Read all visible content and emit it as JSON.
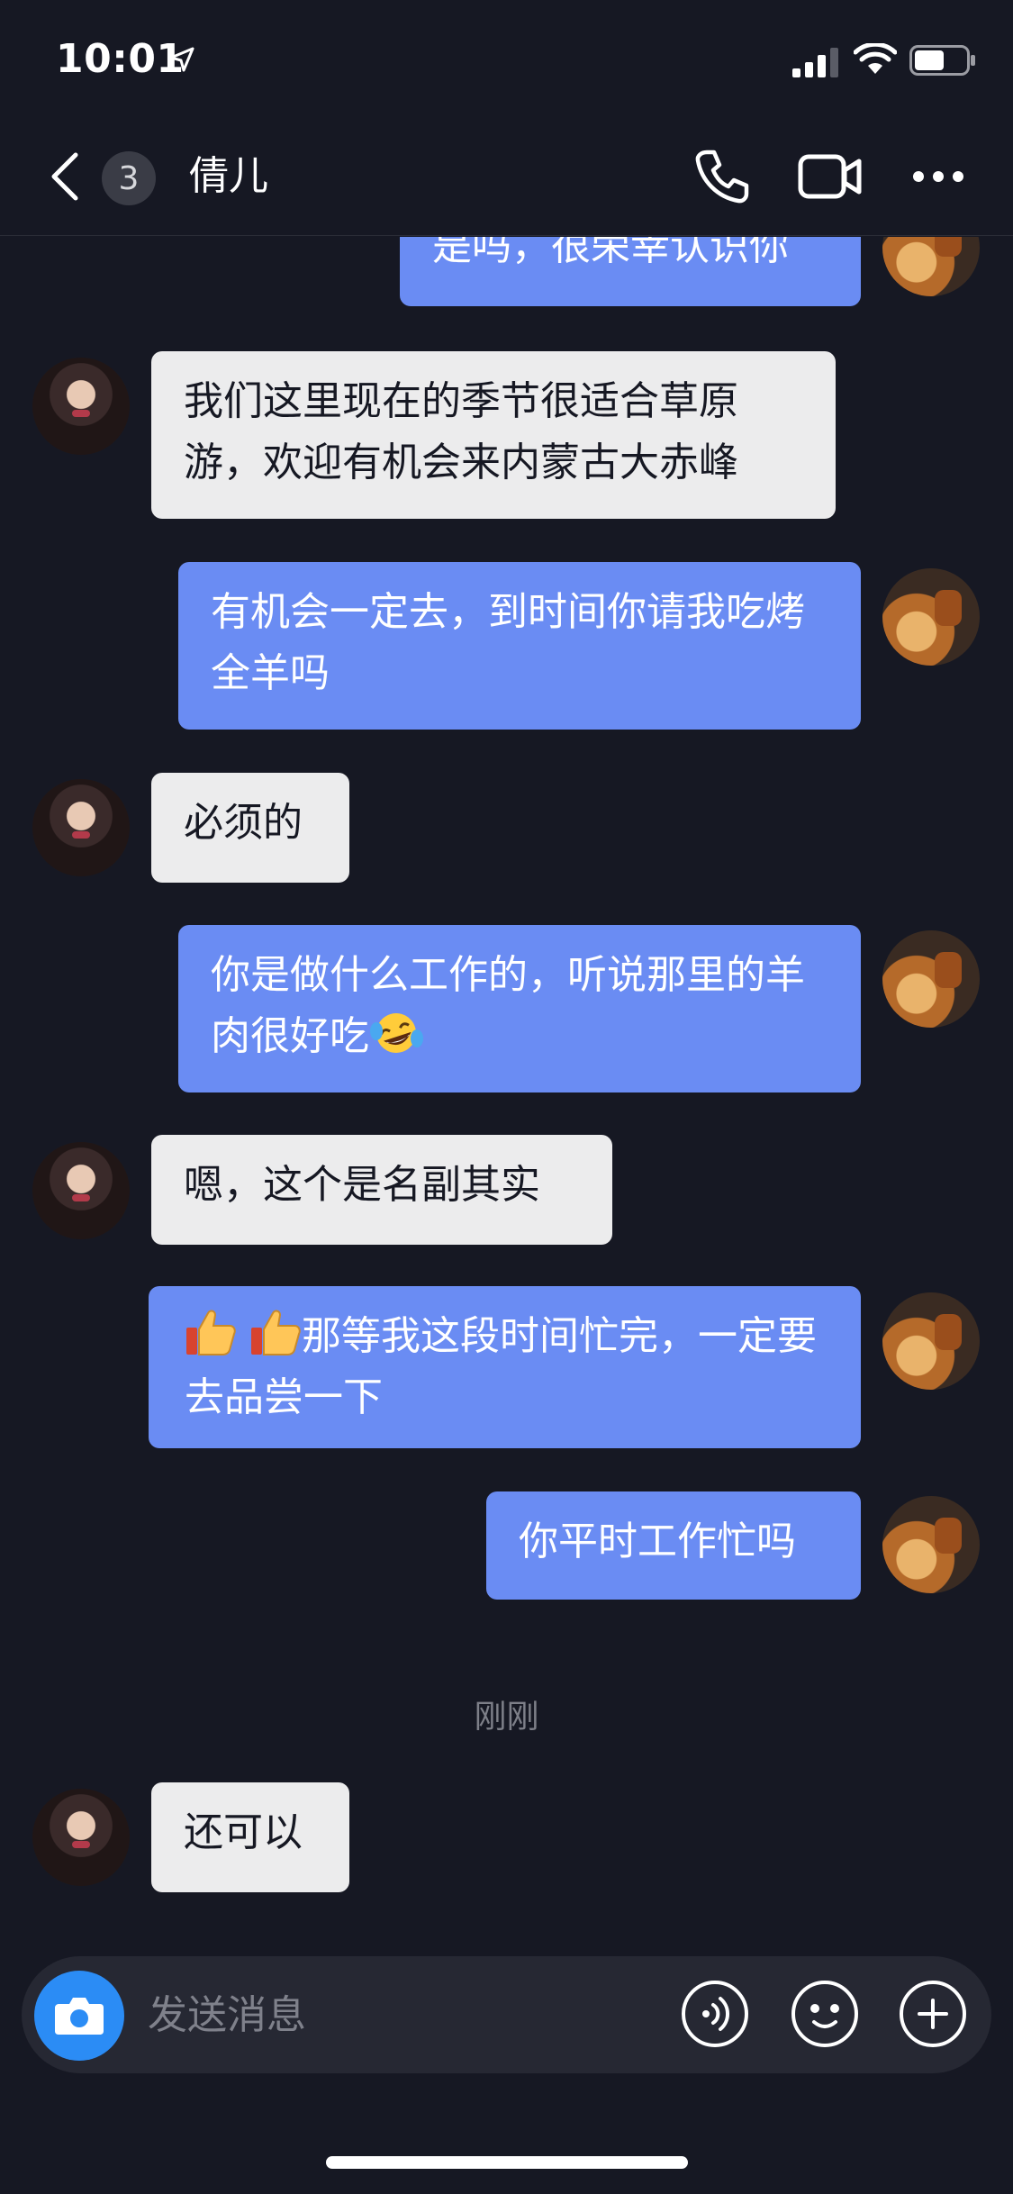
{
  "status_bar": {
    "time": "10:01",
    "icons": [
      "location-arrow-icon",
      "signal-icon",
      "wifi-icon",
      "battery-icon"
    ]
  },
  "header": {
    "unread_count": "3",
    "contact_name": "倩儿",
    "icons": [
      "back-chevron-icon",
      "phone-icon",
      "video-camera-icon",
      "more-dots-icon"
    ]
  },
  "messages": [
    {
      "from": "me",
      "text": "是吗，很荣幸认识你"
    },
    {
      "from": "her",
      "text": "我们这里现在的季节很适合草原游，欢迎有机会来内蒙古大赤峰"
    },
    {
      "from": "me",
      "text": "有机会一定去，到时间你请我吃烤全羊吗"
    },
    {
      "from": "her",
      "text": "必须的"
    },
    {
      "from": "me",
      "text": "你是做什么工作的，听说那里的羊肉很好吃",
      "emoji": "laughing-tears-emoji"
    },
    {
      "from": "her",
      "text": "嗯，这个是名副其实"
    },
    {
      "from": "me",
      "text": "那等我这段时间忙完，一定要去品尝一下",
      "emoji": "thumbs-up-emoji"
    },
    {
      "from": "me",
      "text": "你平时工作忙吗"
    },
    {
      "from": "her",
      "text": "还可以"
    }
  ],
  "time_divider": "刚刚",
  "input_bar": {
    "placeholder": "发送消息",
    "icons": [
      "camera-icon",
      "voice-icon",
      "emoji-face-icon",
      "plus-icon"
    ]
  },
  "colors": {
    "background": "#161823",
    "outgoing_bubble": "#6a8cf3",
    "incoming_bubble": "#ececed",
    "camera_button": "#2b8cf5"
  }
}
